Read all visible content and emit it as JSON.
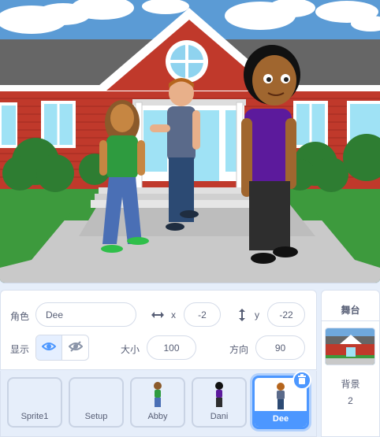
{
  "sprite_info": {
    "sprite_label": "角色",
    "sprite_name": "Dee",
    "x_label": "x",
    "x_value": "-2",
    "y_label": "y",
    "y_value": "-22",
    "show_label": "显示",
    "size_label": "大小",
    "size_value": "100",
    "direction_label": "方向",
    "direction_value": "90"
  },
  "sprites": [
    {
      "name": "Sprite1",
      "selected": false
    },
    {
      "name": "Setup",
      "selected": false
    },
    {
      "name": "Abby",
      "selected": false
    },
    {
      "name": "Dani",
      "selected": false
    },
    {
      "name": "Dee",
      "selected": true
    }
  ],
  "stage_panel": {
    "title": "舞台",
    "backdrops_label": "背景",
    "backdrops_count": "2"
  },
  "icons": {
    "x_axis": "horizontal-arrows-icon",
    "y_axis": "vertical-arrows-icon",
    "show": "eye-icon",
    "hide": "eye-slash-icon",
    "delete": "trash-icon"
  },
  "colors": {
    "accent": "#4c97ff",
    "panel_bg": "#e6eefa",
    "text": "#575e75"
  }
}
